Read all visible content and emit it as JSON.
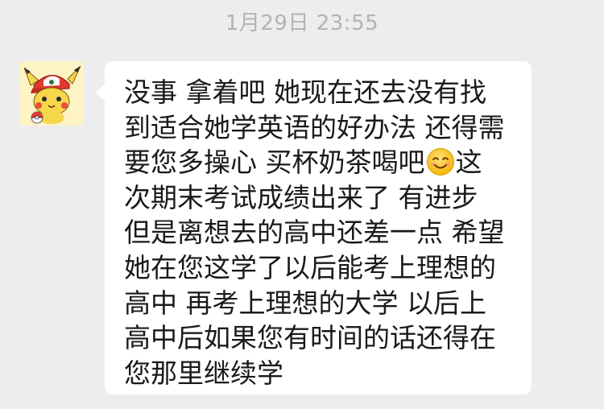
{
  "chat": {
    "timestamp": "1月29日 23:55",
    "message": {
      "sender_avatar_icon": "pikachu-avatar",
      "lines": [
        "没事 拿着吧 她现在还去没有找",
        "到适合她学英语的好办法 还得需",
        "要您多操心 买杯奶茶喝吧",
        "次期末考试成绩出来了 有进步",
        "但是离想去的高中还差一点 希望",
        "她在您这学了以后能考上理想的",
        "高中 再考上理想的大学 以后上",
        "高中后如果您有时间的话还得在",
        "您那里继续学"
      ],
      "line3_after_emoji": "这",
      "emoji_icon": "smiling-face-emoji"
    }
  }
}
